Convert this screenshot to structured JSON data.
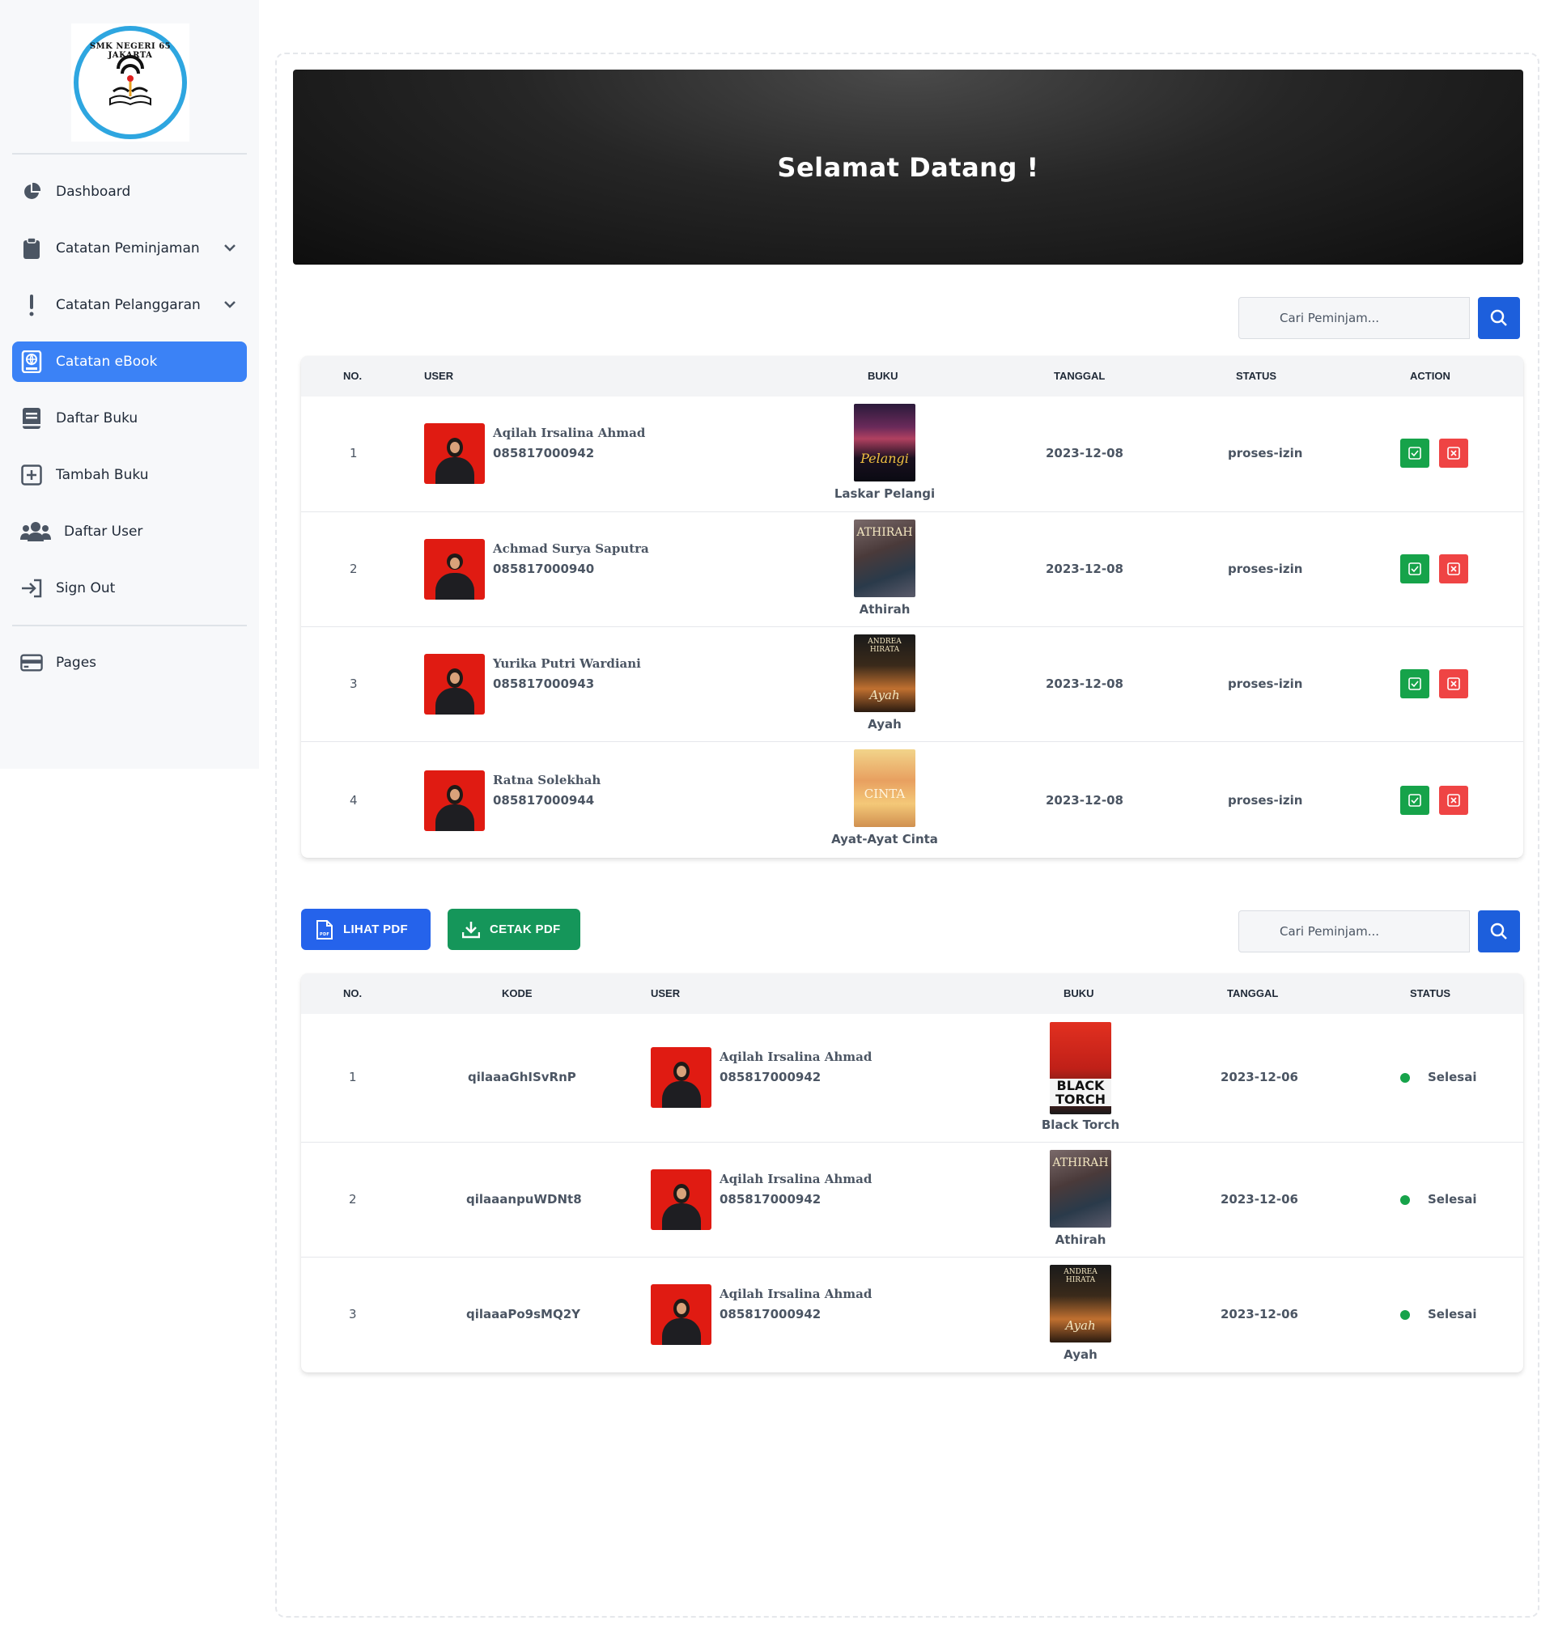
{
  "sidebar": {
    "logo_text": "SMK NEGERI 65 JAKARTA",
    "items": [
      {
        "label": "Dashboard",
        "icon": "pie-chart-icon"
      },
      {
        "label": "Catatan Peminjaman",
        "icon": "clipboard-icon"
      },
      {
        "label": "Catatan Pelanggaran",
        "icon": "exclamation-icon"
      },
      {
        "label": "Catatan eBook",
        "icon": "ebook-icon"
      },
      {
        "label": "Daftar Buku",
        "icon": "book-icon"
      },
      {
        "label": "Tambah Buku",
        "icon": "plus-square-icon"
      },
      {
        "label": "Daftar User",
        "icon": "users-icon"
      },
      {
        "label": "Sign Out",
        "icon": "sign-out-icon"
      },
      {
        "label": "Pages",
        "icon": "pages-icon"
      }
    ],
    "active_item": "Catatan eBook"
  },
  "banner": {
    "title": "Selamat Datang !"
  },
  "search1": {
    "placeholder": "Cari Peminjam..."
  },
  "search2": {
    "placeholder": "Cari Peminjam..."
  },
  "table1": {
    "headers": [
      "NO.",
      "USER",
      "BUKU",
      "TANGGAL",
      "STATUS",
      "ACTION"
    ],
    "rows": [
      {
        "no": "1",
        "name": "Aqilah Irsalina Ahmad",
        "phone": "085817000942",
        "book": "Laskar Pelangi",
        "date": "2023-12-08",
        "status": "proses-izin"
      },
      {
        "no": "2",
        "name": "Achmad Surya Saputra",
        "phone": "085817000940",
        "book": "Athirah",
        "date": "2023-12-08",
        "status": "proses-izin"
      },
      {
        "no": "3",
        "name": "Yurika Putri Wardiani",
        "phone": "085817000943",
        "book": "Ayah",
        "date": "2023-12-08",
        "status": "proses-izin"
      },
      {
        "no": "4",
        "name": "Ratna Solekhah",
        "phone": "085817000944",
        "book": "Ayat-Ayat Cinta",
        "date": "2023-12-08",
        "status": "proses-izin"
      }
    ]
  },
  "buttons": {
    "view_pdf": "LIHAT PDF",
    "print_pdf": "CETAK PDF"
  },
  "table2": {
    "headers": [
      "NO.",
      "KODE",
      "USER",
      "BUKU",
      "TANGGAL",
      "STATUS"
    ],
    "rows": [
      {
        "no": "1",
        "code": "qilaaaGhISvRnP",
        "name": "Aqilah Irsalina Ahmad",
        "phone": "085817000942",
        "book": "Black Torch",
        "date": "2023-12-06",
        "status": "Selesai"
      },
      {
        "no": "2",
        "code": "qilaaanpuWDNt8",
        "name": "Aqilah Irsalina Ahmad",
        "phone": "085817000942",
        "book": "Athirah",
        "date": "2023-12-06",
        "status": "Selesai"
      },
      {
        "no": "3",
        "code": "qilaaaPo9sMQ2Y",
        "name": "Aqilah Irsalina Ahmad",
        "phone": "085817000942",
        "book": "Ayah",
        "date": "2023-12-06",
        "status": "Selesai"
      }
    ]
  },
  "colors": {
    "accent": "#3b82f6",
    "search_button": "#1d5fdc",
    "approve": "#16a34a",
    "reject": "#ef4444",
    "status_done": "#16a34a"
  }
}
